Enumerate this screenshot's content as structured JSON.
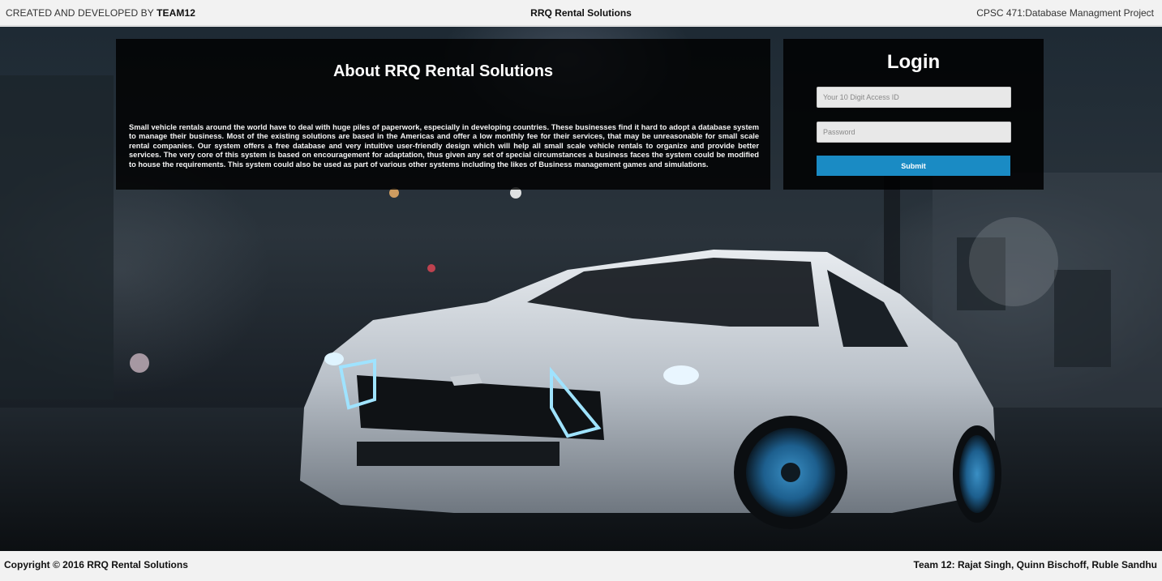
{
  "header": {
    "credit_prefix": "CREATED AND DEVELOPED BY",
    "credit_team": "TEAM12",
    "title": "RRQ Rental Solutions",
    "project": "CPSC 471:Database Managment Project"
  },
  "about": {
    "heading": "About RRQ Rental Solutions",
    "body": "Small vehicle rentals around the world have to deal with huge piles of paperwork, especially in developing countries. These businesses find it hard to adopt a database system to manage their business. Most of the existing solutions are based in the Americas and offer a low monthly fee for their services, that may be unreasonable for small scale rental companies. Our system offers a free database and very intuitive user-friendly design which will help all small scale vehicle rentals to organize and provide better services. The very core of this system is based on encouragement for adaptation, thus given any set of special circumstances a business faces the system could be modified to house the requirements. This system could also be used as part of various other systems including the likes of Business management games and simulations."
  },
  "login": {
    "title": "Login",
    "access_id_placeholder": "Your 10 Digit Access ID",
    "password_placeholder": "Password",
    "submit_label": "Submit"
  },
  "footer": {
    "copyright": "Copyright © 2016 RRQ Rental Solutions",
    "team": "Team 12: Rajat Singh, Quinn Bischoff, Ruble Sandhu"
  },
  "colors": {
    "accent": "#1a8bc4",
    "panel": "#000000",
    "bar": "#f2f2f2"
  }
}
